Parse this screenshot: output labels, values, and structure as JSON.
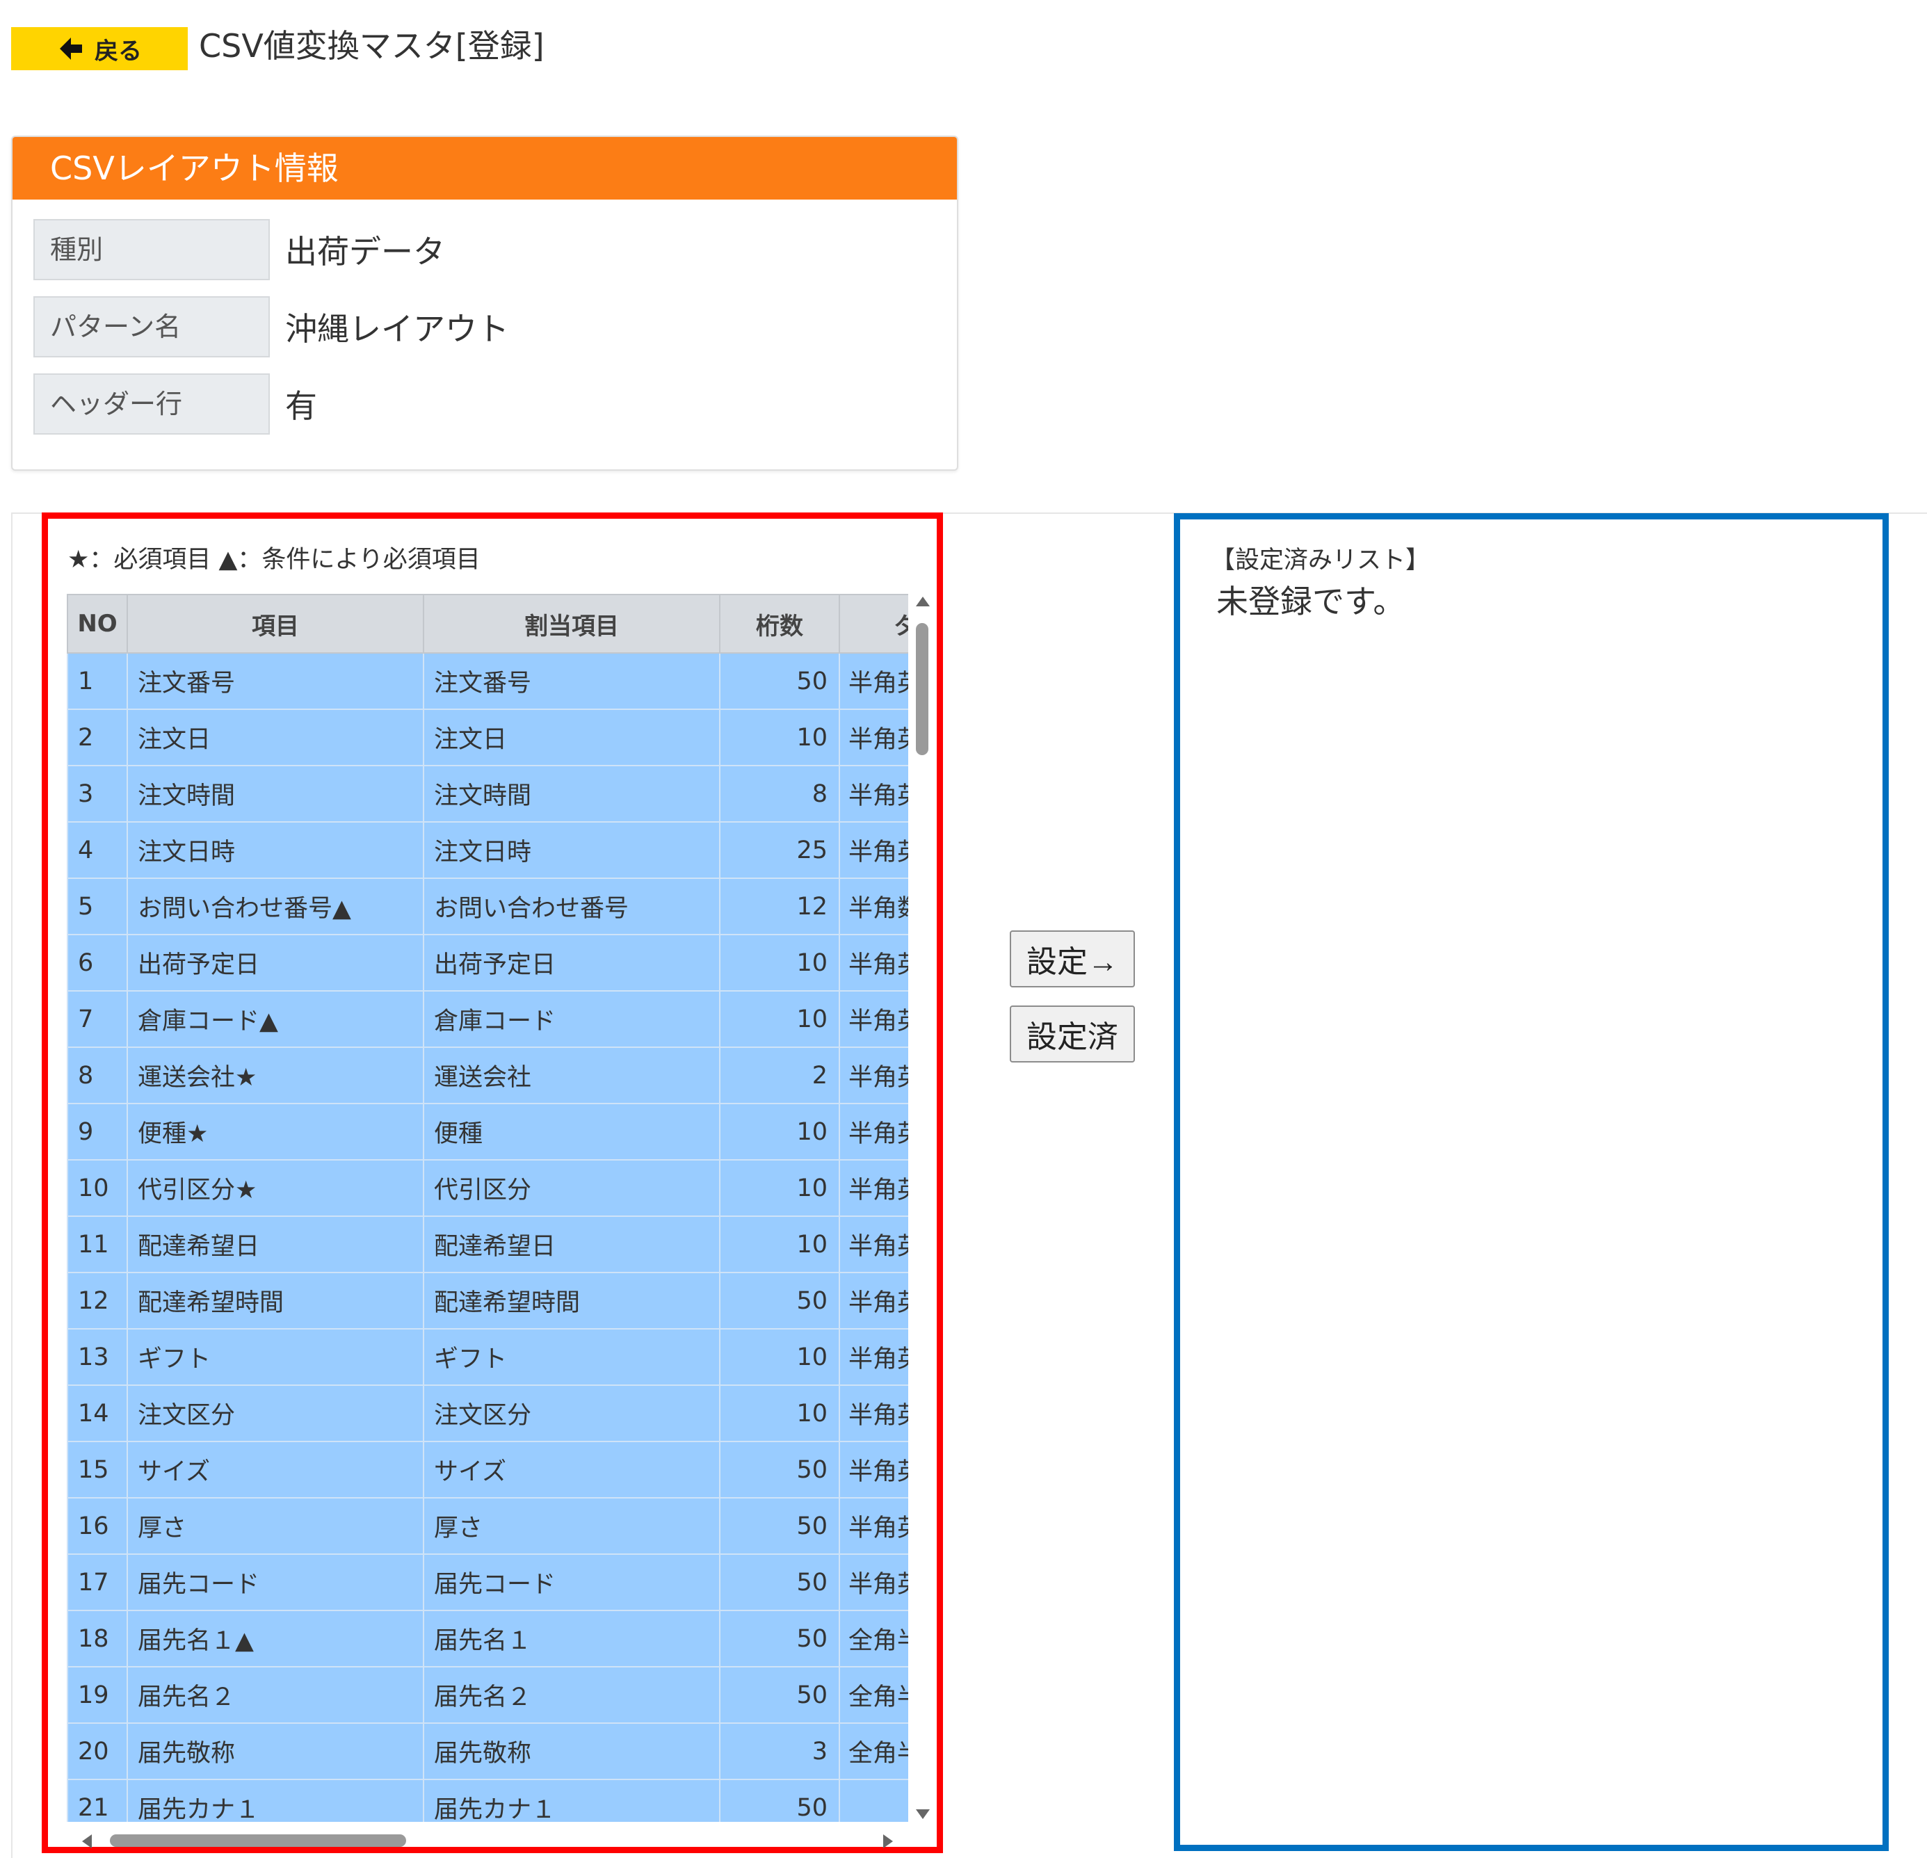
{
  "header": {
    "back_label": "戻る",
    "title": "CSV値変換マスタ[登録]"
  },
  "info": {
    "heading": "CSVレイアウト情報",
    "rows": [
      {
        "label": "種別",
        "value": "出荷データ"
      },
      {
        "label": "パターン名",
        "value": "沖縄レイアウト"
      },
      {
        "label": "ヘッダー行",
        "value": "有"
      }
    ]
  },
  "legend": "★：必須項目 ▲：条件により必須項目",
  "table": {
    "headers": [
      "NO",
      "項目",
      "割当項目",
      "桁数",
      "タ"
    ],
    "rows": [
      {
        "no": "1",
        "item": "注文番号",
        "assigned": "注文番号",
        "digits": "50",
        "type": "半角英"
      },
      {
        "no": "2",
        "item": "注文日",
        "assigned": "注文日",
        "digits": "10",
        "type": "半角英"
      },
      {
        "no": "3",
        "item": "注文時間",
        "assigned": "注文時間",
        "digits": "8",
        "type": "半角英"
      },
      {
        "no": "4",
        "item": "注文日時",
        "assigned": "注文日時",
        "digits": "25",
        "type": "半角英"
      },
      {
        "no": "5",
        "item": "お問い合わせ番号▲",
        "assigned": "お問い合わせ番号",
        "digits": "12",
        "type": "半角数"
      },
      {
        "no": "6",
        "item": "出荷予定日",
        "assigned": "出荷予定日",
        "digits": "10",
        "type": "半角英"
      },
      {
        "no": "7",
        "item": "倉庫コード▲",
        "assigned": "倉庫コード",
        "digits": "10",
        "type": "半角英"
      },
      {
        "no": "8",
        "item": "運送会社★",
        "assigned": "運送会社",
        "digits": "2",
        "type": "半角英"
      },
      {
        "no": "9",
        "item": "便種★",
        "assigned": "便種",
        "digits": "10",
        "type": "半角英"
      },
      {
        "no": "10",
        "item": "代引区分★",
        "assigned": "代引区分",
        "digits": "10",
        "type": "半角英"
      },
      {
        "no": "11",
        "item": "配達希望日",
        "assigned": "配達希望日",
        "digits": "10",
        "type": "半角英"
      },
      {
        "no": "12",
        "item": "配達希望時間",
        "assigned": "配達希望時間",
        "digits": "50",
        "type": "半角英"
      },
      {
        "no": "13",
        "item": "ギフト",
        "assigned": "ギフト",
        "digits": "10",
        "type": "半角英"
      },
      {
        "no": "14",
        "item": "注文区分",
        "assigned": "注文区分",
        "digits": "10",
        "type": "半角英"
      },
      {
        "no": "15",
        "item": "サイズ",
        "assigned": "サイズ",
        "digits": "50",
        "type": "半角英"
      },
      {
        "no": "16",
        "item": "厚さ",
        "assigned": "厚さ",
        "digits": "50",
        "type": "半角英"
      },
      {
        "no": "17",
        "item": "届先コード",
        "assigned": "届先コード",
        "digits": "50",
        "type": "半角英"
      },
      {
        "no": "18",
        "item": "届先名１▲",
        "assigned": "届先名１",
        "digits": "50",
        "type": "全角半"
      },
      {
        "no": "19",
        "item": "届先名２",
        "assigned": "届先名２",
        "digits": "50",
        "type": "全角半"
      },
      {
        "no": "20",
        "item": "届先敬称",
        "assigned": "届先敬称",
        "digits": "3",
        "type": "全角半"
      },
      {
        "no": "21",
        "item": "届先カナ１",
        "assigned": "届先カナ１",
        "digits": "50",
        "type": ""
      }
    ]
  },
  "buttons": {
    "set": "設定→",
    "done": "設定済"
  },
  "right": {
    "title": "【設定済みリスト】",
    "empty": "未登録です。"
  }
}
